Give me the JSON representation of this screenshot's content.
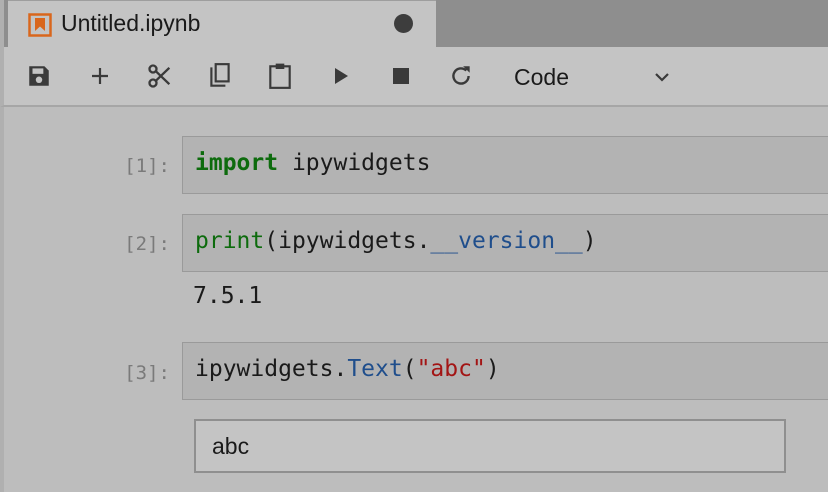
{
  "tab": {
    "title": "Untitled.ipynb",
    "icon": "notebook-icon",
    "unsaved_indicator": "dirty-dot"
  },
  "toolbar": {
    "buttons": [
      "save-icon",
      "add-icon",
      "cut-icon",
      "copy-icon",
      "paste-icon",
      "run-icon",
      "stop-icon",
      "restart-icon"
    ],
    "cell_type": "Code"
  },
  "cells": [
    {
      "prompt": "[1]:",
      "code_tokens": {
        "kw": "import",
        "rest": " ipywidgets"
      }
    },
    {
      "prompt": "[2]:",
      "code_tokens": {
        "fn": "print",
        "open": "(ipywidgets.",
        "attr": "__version__",
        "close": ")"
      },
      "output": "7.5.1"
    },
    {
      "prompt": "[3]:",
      "code_tokens": {
        "obj": "ipywidgets.",
        "attr": "Text",
        "open": "(",
        "str": "\"abc\"",
        "close": ")"
      },
      "widget_value": "abc"
    }
  ],
  "colors": {
    "accent": "#d9661c",
    "keyword": "#0d6b0d",
    "attribute": "#1f4e8c",
    "string": "#a31515"
  }
}
